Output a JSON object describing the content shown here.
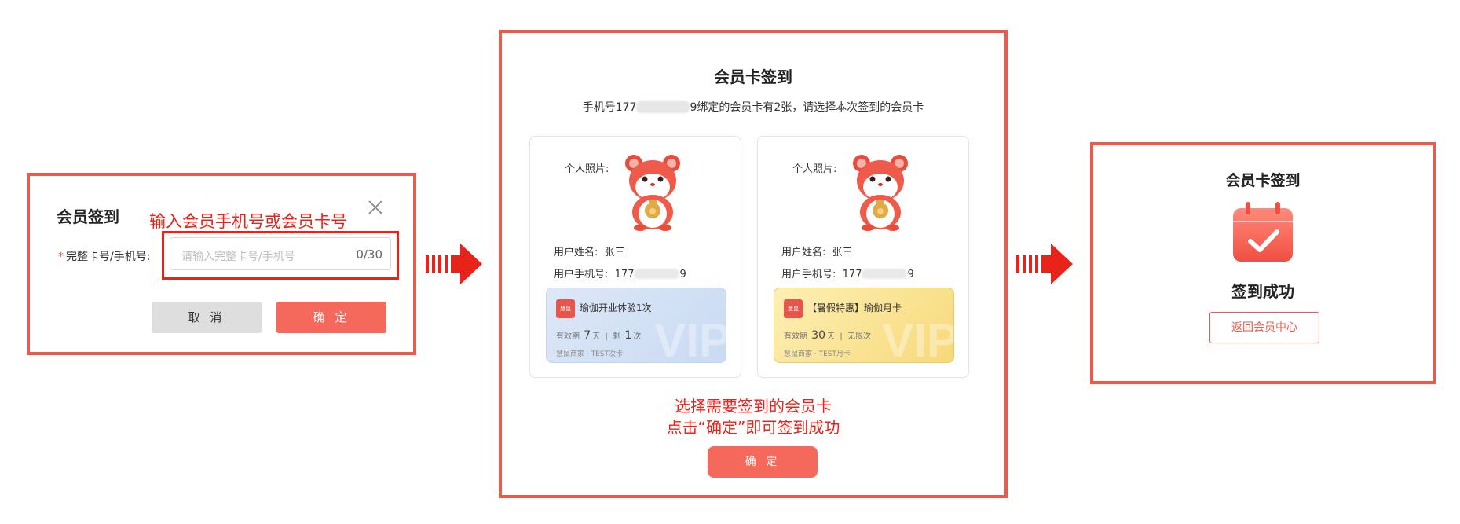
{
  "panel1": {
    "title": "会员签到",
    "hint": "输入会员手机号或会员卡号",
    "required_mark": "*",
    "field_label": "完整卡号/手机号:",
    "input_placeholder": "请输入完整卡号/手机号",
    "input_value": "",
    "char_count": "0/30",
    "cancel_label": "取 消",
    "confirm_label": "确 定"
  },
  "panel2": {
    "title": "会员卡签到",
    "subtitle_prefix": "手机号177",
    "subtitle_suffix": "9绑定的会员卡有2张，请选择本次签到的会员卡",
    "cards": [
      {
        "photo_label": "个人照片:",
        "name_label": "用户姓名:",
        "name_value": "张三",
        "phone_label": "用户手机号:",
        "phone_prefix": "177",
        "phone_suffix": "9",
        "card_name": "瑜伽开业体验1次",
        "validity_label": "有效期",
        "validity_value": "7",
        "validity_unit": "天",
        "count_label": "剩",
        "count_value": "1",
        "count_unit": "次",
        "shop": "慧鼠商家 · TEST次卡",
        "watermark": "VIP",
        "logo_text": "慧鼠"
      },
      {
        "photo_label": "个人照片:",
        "name_label": "用户姓名:",
        "name_value": "张三",
        "phone_label": "用户手机号:",
        "phone_prefix": "177",
        "phone_suffix": "9",
        "card_name": "【暑假特惠】瑜伽月卡",
        "validity_label": "有效期",
        "validity_value": "30",
        "validity_unit": "天",
        "count_label": "",
        "count_value": "",
        "count_unit": "无限次",
        "shop": "慧鼠商家 · TEST月卡",
        "watermark": "VIP",
        "logo_text": "慧鼠"
      }
    ],
    "hint_line1": "选择需要签到的会员卡",
    "hint_line2": "点击“确定”即可签到成功",
    "confirm_label": "确 定"
  },
  "panel3": {
    "title": "会员卡签到",
    "success_text": "签到成功",
    "back_label": "返回会员中心"
  },
  "colors": {
    "accent": "#f4695b",
    "frame": "#ec5a4a",
    "annotation": "#e8231a"
  }
}
